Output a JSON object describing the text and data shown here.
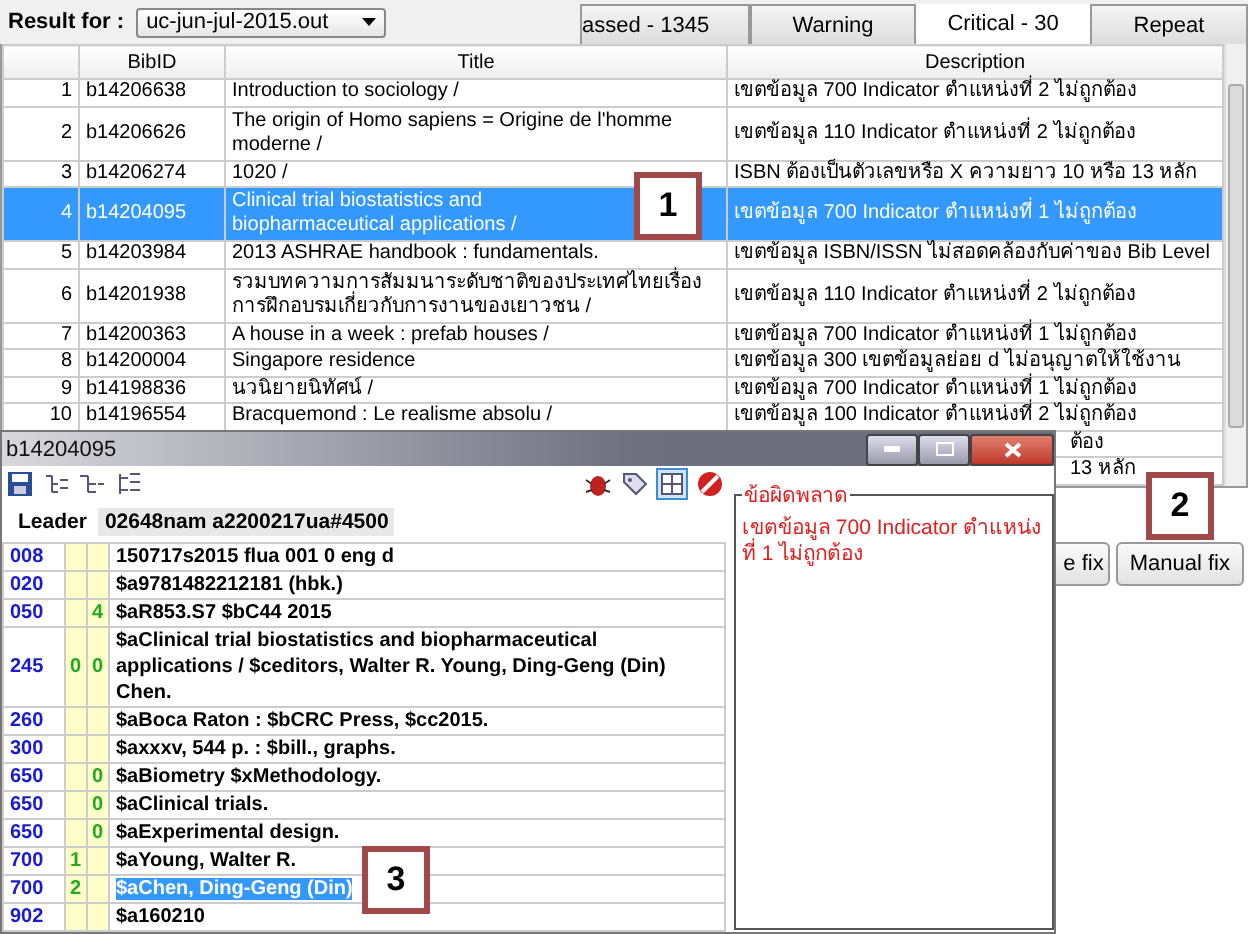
{
  "result_for": {
    "label": "Result for :",
    "value": "uc-jun-jul-2015.out"
  },
  "tabs": [
    {
      "label": "assed - 1345",
      "selected": false
    },
    {
      "label": "Warning",
      "selected": false
    },
    {
      "label": "Critical - 30",
      "selected": true
    },
    {
      "label": "Repeat",
      "selected": false
    }
  ],
  "table": {
    "columns": [
      "BibID",
      "Title",
      "Description"
    ],
    "rows": [
      {
        "no": "1",
        "bibid": "b14206638",
        "title": "Introduction to sociology /",
        "description": "เขตข้อมูล 700 Indicator ตำแหน่งที่ 2 ไม่ถูกต้อง",
        "selected": false
      },
      {
        "no": "2",
        "bibid": "b14206626",
        "title": "The origin of Homo sapiens =  Origine de l'homme moderne /",
        "description": "เขตข้อมูล 110 Indicator ตำแหน่งที่ 2 ไม่ถูกต้อง",
        "selected": false
      },
      {
        "no": "3",
        "bibid": "b14206274",
        "title": "1020 /",
        "description": "ISBN ต้องเป็นตัวเลขหรือ X ความยาว 10 หรือ 13 หลัก",
        "selected": false
      },
      {
        "no": "4",
        "bibid": "b14204095",
        "title": "Clinical trial biostatistics and biopharmaceutical applications /",
        "description": "เขตข้อมูล 700 Indicator ตำแหน่งที่ 1 ไม่ถูกต้อง",
        "selected": true
      },
      {
        "no": "5",
        "bibid": "b14203984",
        "title": "2013 ASHRAE handbook :  fundamentals.",
        "description": "เขตข้อมูล ISBN/ISSN ไม่สอดคล้องกับค่าของ Bib Level",
        "selected": false
      },
      {
        "no": "6",
        "bibid": "b14201938",
        "title": "รวมบทความการสัมมนาระดับชาติของประเทศไทยเรื่อง การฝึกอบรมเกี่ยวกับการงานของเยาวชน /",
        "description": "เขตข้อมูล 110 Indicator ตำแหน่งที่ 2 ไม่ถูกต้อง",
        "selected": false
      },
      {
        "no": "7",
        "bibid": "b14200363",
        "title": "A house in a week :  prefab houses /",
        "description": "เขตข้อมูล 700 Indicator ตำแหน่งที่ 1 ไม่ถูกต้อง",
        "selected": false
      },
      {
        "no": "8",
        "bibid": "b14200004",
        "title": "Singapore residence",
        "description": "เขตข้อมูล 300 เขตข้อมูลย่อย d ไม่อนุญาตให้ใช้งาน",
        "selected": false
      },
      {
        "no": "9",
        "bibid": "b14198836",
        "title": "นวนิยายนิทัศน์ /",
        "description": "เขตข้อมูล 700 Indicator ตำแหน่งที่ 1 ไม่ถูกต้อง",
        "selected": false
      },
      {
        "no": "10",
        "bibid": "b14196554",
        "title": "Bracquemond :  Le realisme absolu /",
        "description": "เขตข้อมูล 100 Indicator ตำแหน่งที่ 2 ไม่ถูกต้อง",
        "selected": false
      }
    ],
    "partial_rows": [
      {
        "description": "ต้อง"
      },
      {
        "description": "13 หลัก"
      }
    ]
  },
  "buttons": [
    "e fix",
    "Manual fix"
  ],
  "callouts": [
    "1",
    "2",
    "3"
  ],
  "record_window": {
    "title": "b14204095",
    "toolbar": {
      "grid_view_on": true
    },
    "leader": {
      "label": "Leader",
      "value": "02648nam a2200217ua#4500"
    },
    "fields": [
      {
        "tag": "008",
        "data": "150717s2015    flua         001 0 eng d",
        "selected": false
      },
      {
        "tag": "020",
        "data": "$a9781482212181 (hbk.)",
        "selected": false
      },
      {
        "tag": "050",
        "ind2": "4",
        "data": "$aR853.S7 $bC44 2015",
        "selected": false
      },
      {
        "tag": "245",
        "ind1": "0",
        "ind2": "0",
        "data": "$aClinical trial biostatistics and biopharmaceutical applications / $ceditors, Walter R. Young, Ding-Geng (Din) Chen.",
        "selected": false
      },
      {
        "tag": "260",
        "data": "$aBoca Raton : $bCRC Press, $cc2015.",
        "selected": false
      },
      {
        "tag": "300",
        "data": "$axxxv, 544 p. : $bill., graphs.",
        "selected": false
      },
      {
        "tag": "650",
        "ind2": "0",
        "data": "$aBiometry $xMethodology.",
        "selected": false
      },
      {
        "tag": "650",
        "ind2": "0",
        "data": "$aClinical trials.",
        "selected": false
      },
      {
        "tag": "650",
        "ind2": "0",
        "data": "$aExperimental design.",
        "selected": false
      },
      {
        "tag": "700",
        "ind1": "1",
        "data": "$aYoung, Walter R.",
        "selected": false
      },
      {
        "tag": "700",
        "ind1": "2",
        "data": "$aChen, Ding-Geng (Din)",
        "selected": true
      },
      {
        "tag": "902",
        "data": "$a160210",
        "selected": false
      }
    ],
    "errors": {
      "legend": "ข้อผิดพลาด",
      "message": "เขตข้อมูล 700 Indicator ตำแหน่งที่ 1 ไม่ถูกต้อง"
    }
  }
}
